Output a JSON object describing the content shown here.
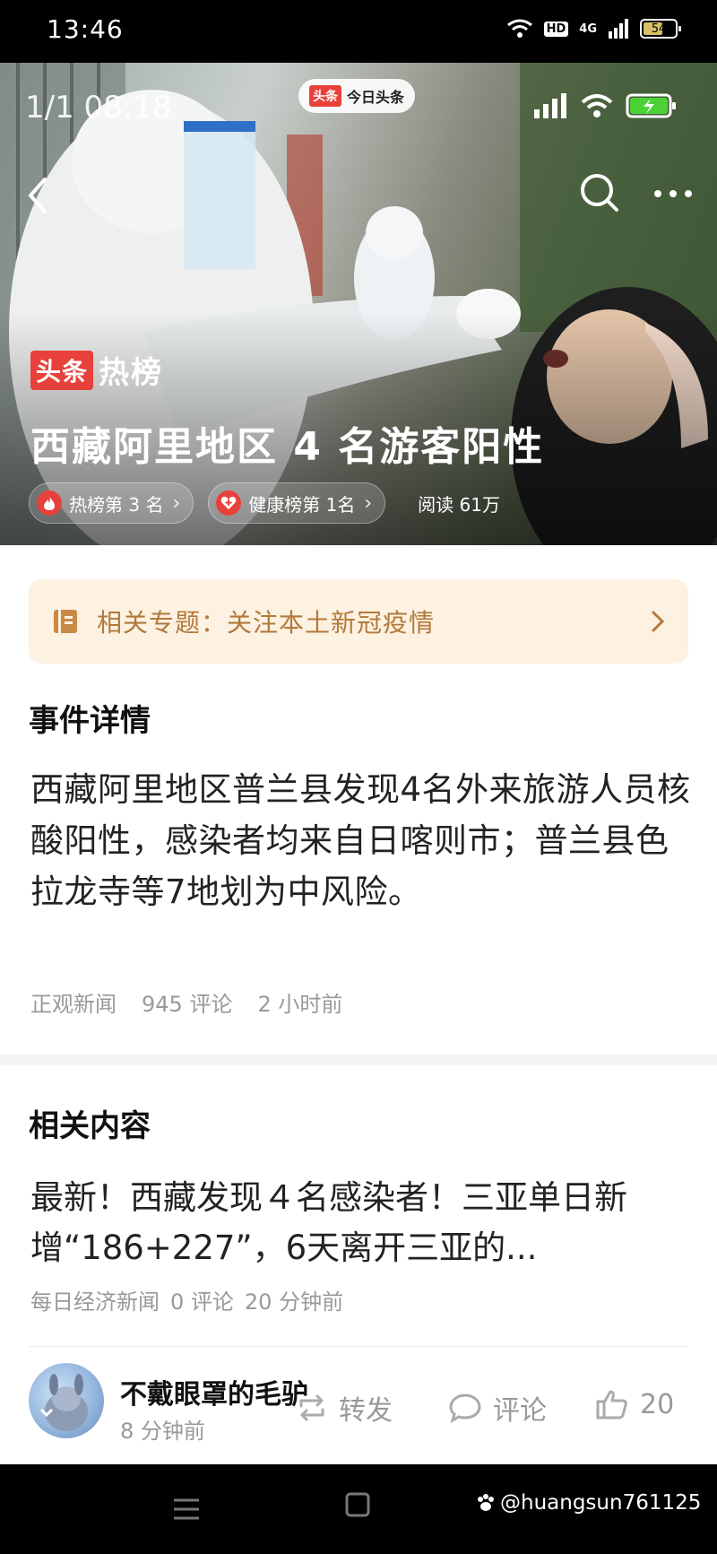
{
  "status_bar": {
    "time": "13:46",
    "hd": "HD",
    "network": "4G",
    "battery": "54"
  },
  "hero": {
    "screenshot_time": "1/1 08:18",
    "app_logo": "头条",
    "app_name": "今日头条",
    "hotlist_logo": "头条",
    "hotlist_label": "热榜",
    "title": "西藏阿里地区 4 名游客阳性",
    "tags": {
      "hot_rank": "热榜第 3 名",
      "health_rank": "健康榜第 1名"
    },
    "read_count": "阅读 61万"
  },
  "topic": {
    "text": "相关专题：关注本土新冠疫情"
  },
  "event": {
    "section_title": "事件详情",
    "body": "西藏阿里地区普兰县发现4名外来旅游人员核酸阳性，感染者均来自日喀则市；普兰县色拉龙寺等7地划为中风险。",
    "source": "正观新闻",
    "comments": "945 评论",
    "time": "2 小时前"
  },
  "related": {
    "section_title": "相关内容",
    "headline": "最新！西藏发现４名感染者！三亚单日新增“186+227”，6天离开三亚的...",
    "source": "每日经济新闻",
    "comments": "0 评论",
    "time": "20 分钟前"
  },
  "comment_bar": {
    "user_name": "不戴眼罩的毛驴",
    "time": "8 分钟前",
    "repost_label": "转发",
    "comment_label": "评论",
    "like_count": "20"
  },
  "watermark": "@huangsun761125",
  "colors": {
    "brand_red": "#e8413b",
    "topic_bg": "#fdf1e2",
    "topic_text": "#b2793a"
  }
}
